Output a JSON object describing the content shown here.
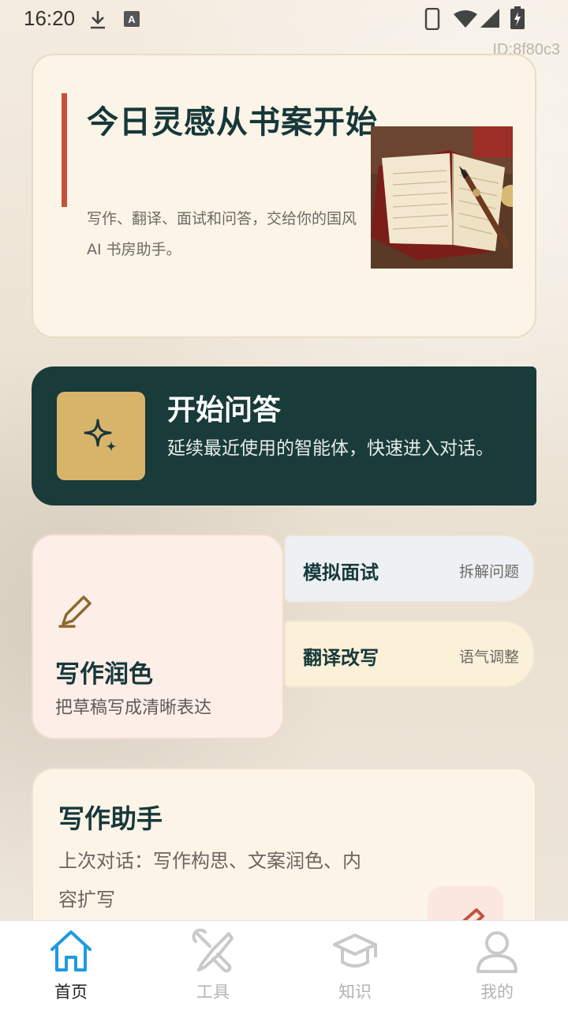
{
  "status_bar": {
    "time": "16:20"
  },
  "screen_id": "ID:8f80c3",
  "hero": {
    "title": "今日灵感从书案开始",
    "description": "写作、翻译、面试和问答，交给你的国风AI 书房助手。"
  },
  "qa_card": {
    "title": "开始问答",
    "description": "延续最近使用的智能体，快速进入对话。",
    "icon": "sparkle-icon"
  },
  "writing_card": {
    "title": "写作润色",
    "subtitle": "把草稿写成清晰表达",
    "icon": "pen-icon"
  },
  "mock_interview": {
    "title": "模拟面试",
    "tag": "拆解问题"
  },
  "translate": {
    "title": "翻译改写",
    "tag": "语气调整"
  },
  "assistant_card": {
    "title": "写作助手",
    "description": "上次对话：写作构思、文案润色、内容扩写"
  },
  "tabs": [
    {
      "label": "首页",
      "icon": "home-icon",
      "active": true
    },
    {
      "label": "工具",
      "icon": "tools-icon",
      "active": false
    },
    {
      "label": "知识",
      "icon": "graduation-cap-icon",
      "active": false
    },
    {
      "label": "我的",
      "icon": "user-icon",
      "active": false
    }
  ],
  "colors": {
    "primary_dark": "#193b3a",
    "accent_gold": "#d8b46b",
    "accent_red": "#c5513b",
    "tab_active": "#1e9be0"
  }
}
